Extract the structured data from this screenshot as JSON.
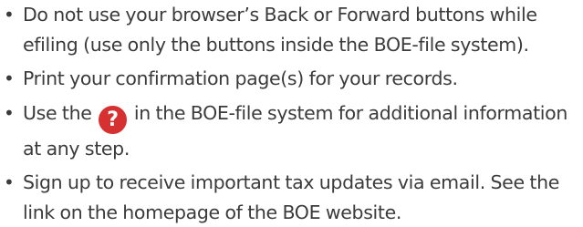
{
  "tips": {
    "back_forward": "Do not use your browser’s Back or Forward buttons while efiling (use only the buttons inside the BOE-file system).",
    "print": "Print your confirmation page(s) for your records.",
    "help_before": "Use the",
    "help_icon_glyph": "?",
    "help_after": "in the BOE-file system for additional information at any step.",
    "signup": "Sign up to receive important tax updates via email. See the link on the homepage of the BOE website."
  },
  "colors": {
    "text": "#3b3b3b",
    "help_icon_bg": "#d63031"
  },
  "bullet_char": "•"
}
